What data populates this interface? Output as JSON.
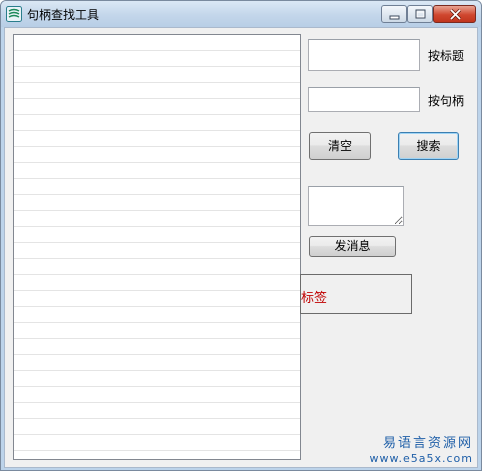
{
  "window": {
    "title": "句柄查找工具",
    "icon": "app-icon",
    "caption_buttons": [
      "minimize-icon",
      "maximize-icon",
      "close-icon"
    ]
  },
  "list": {
    "items": []
  },
  "search_by_title": {
    "value": "",
    "label": "按标题"
  },
  "search_by_handle": {
    "value": "",
    "label": "按句柄"
  },
  "buttons": {
    "clear": "清空",
    "search": "搜索",
    "send_message": "发消息"
  },
  "message": {
    "value": ""
  },
  "tag": {
    "text": "标签"
  },
  "watermark": {
    "title": "易语言资源网",
    "url": "www.e5a5x.com"
  },
  "colors": {
    "tag_text": "#c00000",
    "watermark": "#1f5fa8",
    "default_button_border": "#3c7fb1"
  }
}
